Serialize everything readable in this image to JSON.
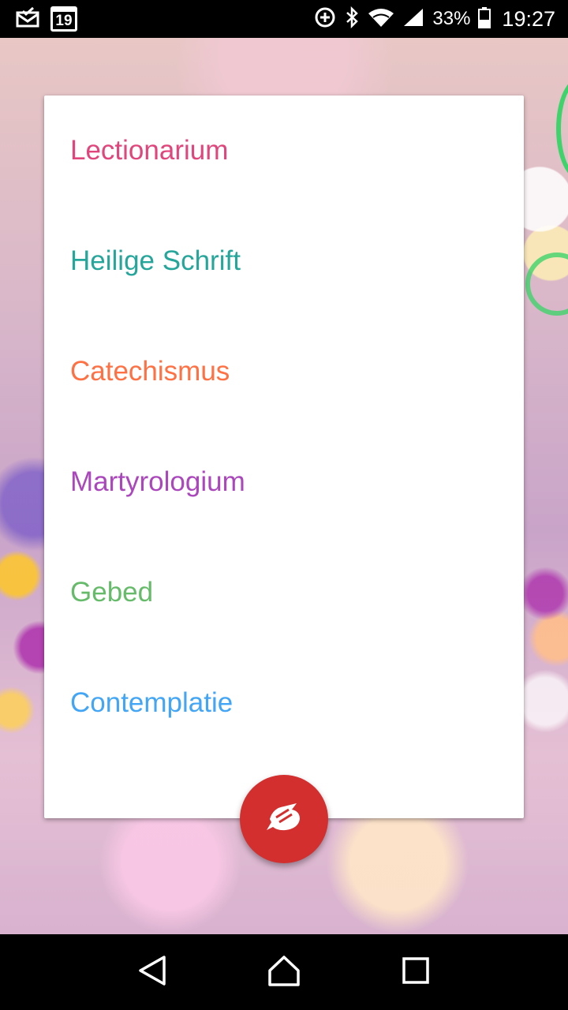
{
  "status_bar": {
    "calendar_day": "19",
    "battery_percent": "33%",
    "time": "19:27",
    "icons": [
      "mail-check-icon",
      "calendar-icon",
      "data-saver-icon",
      "bluetooth-icon",
      "wifi-icon",
      "signal-icon",
      "battery-icon"
    ]
  },
  "menu": {
    "items": [
      {
        "label": "Lectionarium",
        "color": "#e0457b"
      },
      {
        "label": "Heilige Schrift",
        "color": "#26a69a"
      },
      {
        "label": "Catechismus",
        "color": "#ff7043"
      },
      {
        "label": "Martyrologium",
        "color": "#ab47bc"
      },
      {
        "label": "Gebed",
        "color": "#66bb6a"
      },
      {
        "label": "Contemplatie",
        "color": "#42a5f5"
      }
    ]
  },
  "fab": {
    "icon": "dove-icon",
    "color": "#d32f2f"
  },
  "nav_bar": {
    "icons": [
      "back-icon",
      "home-icon",
      "recents-icon"
    ]
  }
}
